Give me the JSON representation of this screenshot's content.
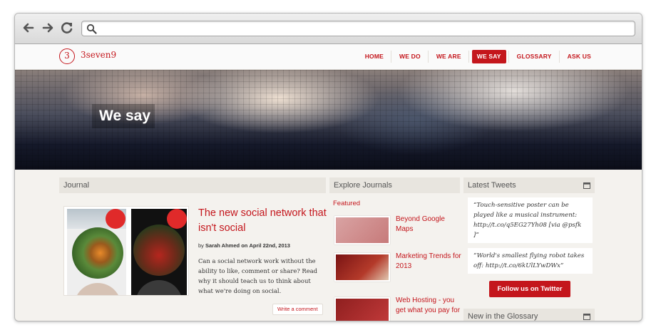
{
  "browser": {
    "back_icon": "back-arrow-icon",
    "forward_icon": "forward-arrow-icon",
    "reload_icon": "reload-icon",
    "search_icon": "search-icon",
    "url_value": ""
  },
  "site": {
    "logo_mark": "3",
    "logo_text": "3seven9",
    "brand_color": "#c4161c"
  },
  "nav": {
    "items": [
      {
        "label": "HOME",
        "active": false
      },
      {
        "label": "WE DO",
        "active": false
      },
      {
        "label": "WE ARE",
        "active": false
      },
      {
        "label": "WE SAY",
        "active": true
      },
      {
        "label": "GLOSSARY",
        "active": false
      },
      {
        "label": "ASK US",
        "active": false
      }
    ]
  },
  "hero": {
    "title": "We say"
  },
  "journal": {
    "heading": "Journal",
    "post": {
      "title": "The new social network that isn't social",
      "author_prefix": "by",
      "author": "Sarah Ahmed",
      "date_prefix": "on",
      "date": "April 22nd, 2013",
      "excerpt": "Can a social network work without the ability to like, comment or share? Read why it should teach us to think about what we're doing on social.",
      "comment_button": "Write a comment"
    }
  },
  "explore": {
    "heading": "Explore Journals",
    "featured_label": "Featured",
    "items": [
      {
        "label": "Beyond Google Maps"
      },
      {
        "label": "Marketing Trends for 2013"
      },
      {
        "label": "Web Hosting - you get what you pay for"
      }
    ]
  },
  "tweets": {
    "heading": "Latest Tweets",
    "items": [
      {
        "text": "“Touch-sensitive poster can be played like a musical instrument: http://t.co/q5EG27Yh08 [via @psfk ]”"
      },
      {
        "text": "“World's smallest flying robot takes off: http://t.co/6kUlLYwDWx”"
      }
    ],
    "follow_button": "Follow us on Twitter"
  },
  "glossary": {
    "heading": "New in the Glossary"
  }
}
